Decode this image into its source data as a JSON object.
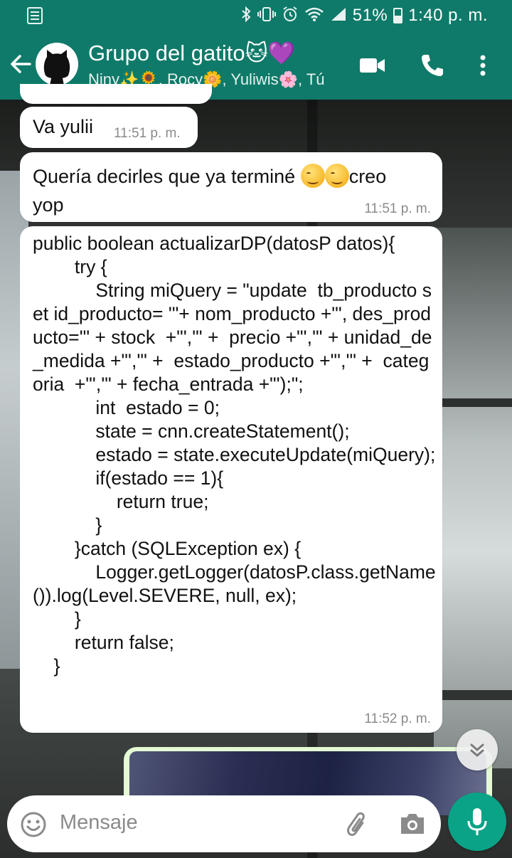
{
  "status_bar": {
    "battery": "51%",
    "time": "1:40 p. m."
  },
  "header": {
    "title": "Grupo del gatito🐱💜",
    "members": "Niny✨🌻, Rocy🌼, Yuliwis🌸, Tú"
  },
  "messages": [
    {
      "text": "Va yulii",
      "time": "11:51 p. m."
    },
    {
      "text_line1": "Quería decirles que ya terminé ",
      "text_after_emoji": "creo",
      "text_line2": "yop",
      "time": "11:51 p. m."
    },
    {
      "code": "public boolean actualizarDP(datosP datos){\n        try {\n            String miQuery = \"update  tb_producto set id_producto= '\"+ nom_producto +\"', des_producto='\" + stock  +\"','\" +  precio +\"','\" + unidad_de_medida +\"','\" +  estado_producto +\"','\" +  categoria  +\"','\" + fecha_entrada +\"');\";\n            int  estado = 0;\n            state = cnn.createStatement();\n            estado = state.executeUpdate(miQuery);\n            if(estado == 1){\n                return true;\n            }\n        }catch (SQLException ex) {\n            Logger.getLogger(datosP.class.getName()).log(Level.SEVERE, null, ex);\n        }\n        return false;\n    }",
      "time": "11:52 p. m."
    }
  ],
  "input": {
    "placeholder": "Mensaje"
  },
  "colors": {
    "header": "#0f7a69",
    "mic": "#0aa387",
    "outgoing": "#e4f9d4"
  }
}
